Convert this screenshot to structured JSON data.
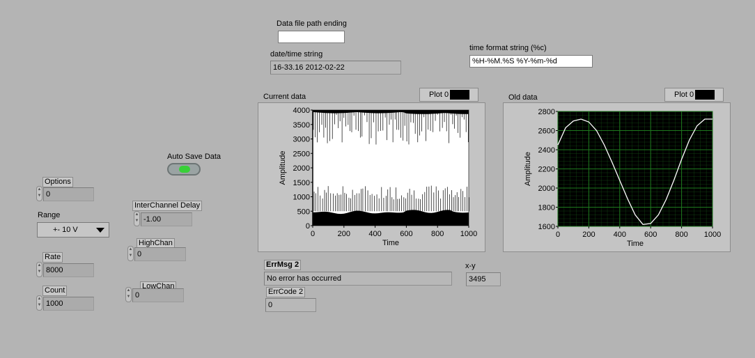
{
  "data_file": {
    "label": "Data file path ending",
    "value": ""
  },
  "datetime": {
    "label": "date/time string",
    "value": "16-33.16 2012-02-22"
  },
  "time_format": {
    "label": "time format string (%c)",
    "value": "%H-%M.%S %Y-%m-%d"
  },
  "auto_save": {
    "label": "Auto Save Data"
  },
  "options": {
    "label": "Options",
    "value": "0"
  },
  "range": {
    "label": "Range",
    "value": "+- 10 V"
  },
  "rate": {
    "label": "Rate",
    "value": "8000"
  },
  "count": {
    "label": "Count",
    "value": "1000"
  },
  "interchannel_delay": {
    "label": "InterChannel Delay",
    "value": "-1.00"
  },
  "high_chan": {
    "label": "HighChan",
    "value": "0"
  },
  "low_chan": {
    "label": "LowChan",
    "value": "0"
  },
  "err_msg": {
    "label": "ErrMsg 2",
    "value": "No error has occurred"
  },
  "err_code": {
    "label": "ErrCode 2",
    "value": "0"
  },
  "xy": {
    "label": "x-y",
    "value": "3495"
  },
  "colors": {
    "panel": "#b4b4b4",
    "white_plot_bg": "#ffffff",
    "dark_plot_bg": "#000000",
    "grid_green": "#1f7a1f",
    "led_green": "#38d038"
  },
  "chart_data": [
    {
      "type": "line",
      "title": "Current data",
      "legend": "Plot 0",
      "xlabel": "Time",
      "ylabel": "Amplitude",
      "xlim": [
        0,
        1000
      ],
      "ylim": [
        0,
        4000
      ],
      "xticks": [
        0,
        200,
        400,
        600,
        800,
        1000
      ],
      "yticks": [
        0,
        500,
        1000,
        1500,
        2000,
        2500,
        3000,
        3500,
        4000
      ],
      "grid": false,
      "series": [
        {
          "description_values": "high band near 3900-4000 with downward spikes to ~2800; low band near 400-550 with upward spikes to ~1400",
          "high_band": [
            3950,
            4000
          ],
          "low_band": [
            0,
            500
          ],
          "spike_high_min": 2800,
          "spike_low_max": 1400
        }
      ]
    },
    {
      "type": "line",
      "title": "Old data",
      "legend": "Plot 0",
      "xlabel": "Time",
      "ylabel": "Amplitude",
      "xlim": [
        0,
        1000
      ],
      "ylim": [
        1600,
        2800
      ],
      "xticks": [
        0,
        200,
        400,
        600,
        800,
        1000
      ],
      "yticks": [
        1600,
        1800,
        2000,
        2200,
        2400,
        2600,
        2800
      ],
      "grid": true,
      "series": [
        {
          "x": [
            0,
            50,
            100,
            150,
            200,
            250,
            300,
            350,
            400,
            450,
            500,
            550,
            600,
            650,
            700,
            750,
            800,
            850,
            900,
            950,
            1000
          ],
          "y": [
            2450,
            2630,
            2700,
            2720,
            2690,
            2600,
            2450,
            2270,
            2080,
            1890,
            1720,
            1620,
            1630,
            1720,
            1880,
            2080,
            2300,
            2500,
            2650,
            2720,
            2720
          ]
        }
      ]
    }
  ]
}
